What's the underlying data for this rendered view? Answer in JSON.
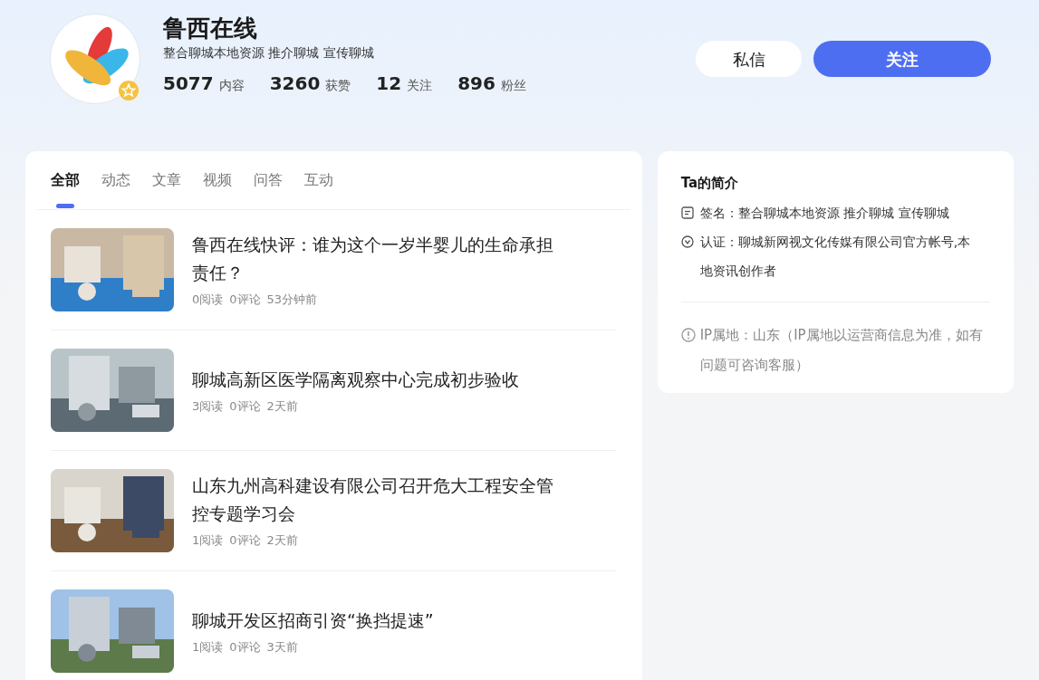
{
  "profile": {
    "name": "鲁西在线",
    "bio": "整合聊城本地资源 推介聊城 宣传聊城",
    "verified": true,
    "stats": [
      {
        "value": "5077",
        "label": "内容"
      },
      {
        "value": "3260",
        "label": "获赞"
      },
      {
        "value": "12",
        "label": "关注"
      },
      {
        "value": "896",
        "label": "粉丝"
      }
    ],
    "buttons": [
      {
        "label": "私信",
        "kind": "secondary"
      },
      {
        "label": "关注",
        "kind": "primary"
      }
    ]
  },
  "tabs": [
    {
      "label": "全部",
      "selected": true
    },
    {
      "label": "动态",
      "selected": false
    },
    {
      "label": "文章",
      "selected": false
    },
    {
      "label": "视频",
      "selected": false
    },
    {
      "label": "问答",
      "selected": false
    },
    {
      "label": "互动",
      "selected": false
    }
  ],
  "feed": [
    {
      "title": "鲁西在线快评：谁为这个一岁半婴儿的生命承担责任？",
      "reads": "0阅读",
      "comments": "0评论",
      "time": "53分钟前"
    },
    {
      "title": "聊城高新区医学隔离观察中心完成初步验收",
      "reads": "3阅读",
      "comments": "0评论",
      "time": "2天前"
    },
    {
      "title": "山东九州高科建设有限公司召开危大工程安全管控专题学习会",
      "reads": "1阅读",
      "comments": "0评论",
      "time": "2天前"
    },
    {
      "title": "聊城开发区招商引资“换挡提速”",
      "reads": "1阅读",
      "comments": "0评论",
      "time": "3天前"
    }
  ],
  "intro": {
    "title": "Ta的简介",
    "signature": "签名：整合聊城本地资源 推介聊城 宣传聊城",
    "certification": "认证：聊城新网视文化传媒有限公司官方帐号,本地资讯创作者",
    "ip_note": "IP属地：山东（IP属地以运营商信息为准，如有问题可咨询客服）"
  }
}
